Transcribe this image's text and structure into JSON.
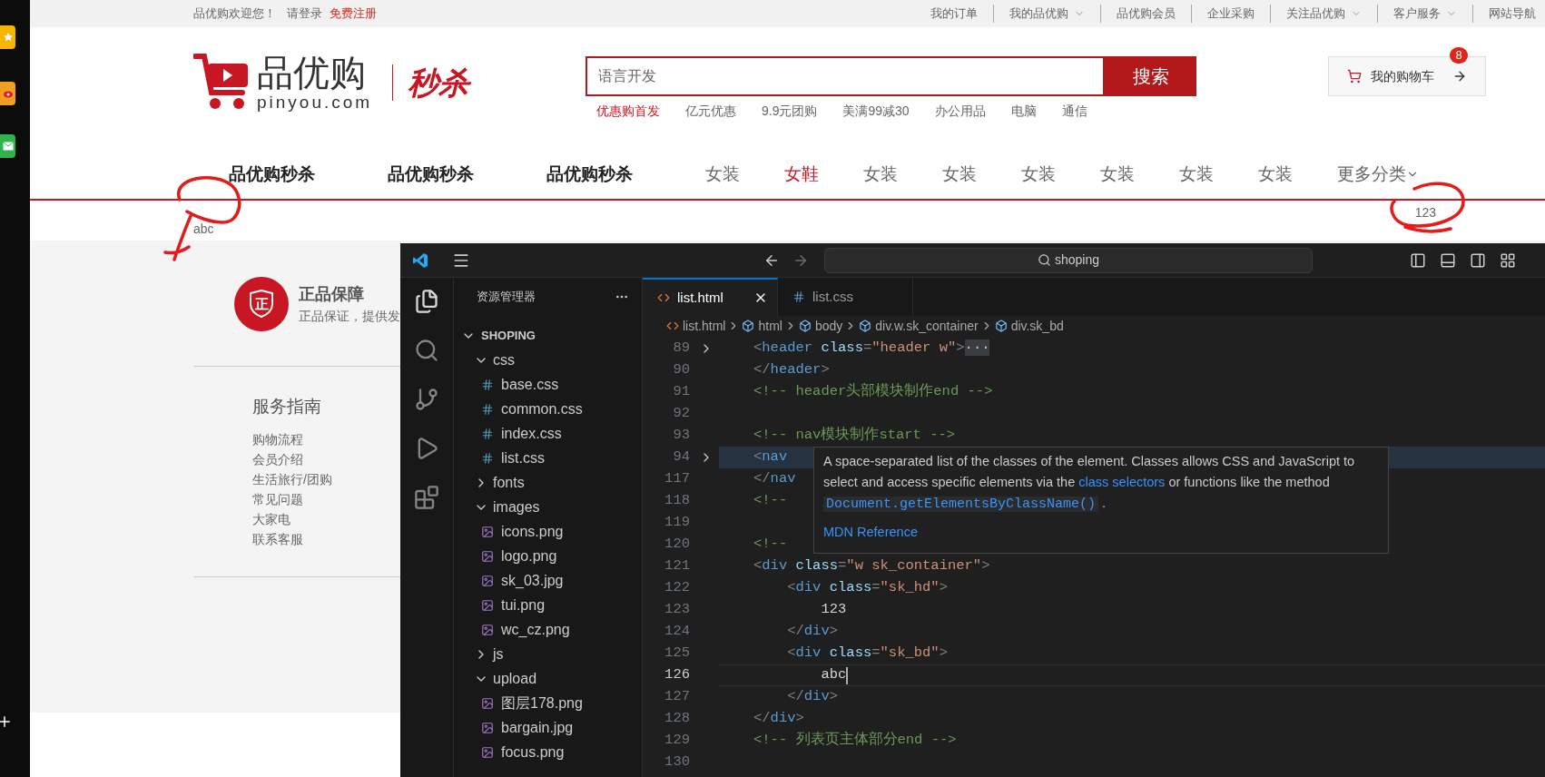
{
  "top_bar": {
    "welcome": "品优购欢迎您！",
    "login": "请登录",
    "register": "免费注册",
    "links": [
      {
        "label": "我的订单",
        "dropdown": false
      },
      {
        "label": "我的品优购",
        "dropdown": true
      },
      {
        "label": "品优购会员",
        "dropdown": false
      },
      {
        "label": "企业采购",
        "dropdown": false
      },
      {
        "label": "关注品优购",
        "dropdown": true
      },
      {
        "label": "客户服务",
        "dropdown": true
      },
      {
        "label": "网站导航",
        "dropdown": false
      }
    ]
  },
  "header": {
    "logo_name": "品优购",
    "logo_domain": "pinyou.com",
    "logo_badge": "秒杀",
    "search": {
      "placeholder": "语言开发",
      "button": "搜索"
    },
    "hot_words": [
      {
        "label": "优惠购首发",
        "highlight": true
      },
      {
        "label": "亿元优惠",
        "highlight": false
      },
      {
        "label": "9.9元团购",
        "highlight": false
      },
      {
        "label": "美满99减30",
        "highlight": false
      },
      {
        "label": "办公用品",
        "highlight": false
      },
      {
        "label": "电脑",
        "highlight": false
      },
      {
        "label": "通信",
        "highlight": false
      }
    ],
    "cart": {
      "label": "我的购物车",
      "count": "8"
    }
  },
  "nav": [
    {
      "label": "品优购秒杀",
      "kind": "bold"
    },
    {
      "label": "品优购秒杀",
      "kind": "bold"
    },
    {
      "label": "品优购秒杀",
      "kind": "bold"
    },
    {
      "label": "女装",
      "kind": "plain"
    },
    {
      "label": "女鞋",
      "kind": "active"
    },
    {
      "label": "女装",
      "kind": "plain"
    },
    {
      "label": "女装",
      "kind": "plain"
    },
    {
      "label": "女装",
      "kind": "plain"
    },
    {
      "label": "女装",
      "kind": "plain"
    },
    {
      "label": "女装",
      "kind": "plain"
    },
    {
      "label": "女装",
      "kind": "plain"
    },
    {
      "label": "更多分类",
      "kind": "more"
    }
  ],
  "sk_header": "123",
  "sk_body": "abc",
  "promise": {
    "icon_text": "正",
    "title": "正品保障",
    "text": "正品保证，提供发"
  },
  "guide": {
    "title": "服务指南",
    "links": [
      "购物流程",
      "会员介绍",
      "生活旅行/团购",
      "常见问题",
      "大家电",
      "联系客服"
    ]
  },
  "editor": {
    "search": "shoping",
    "explorer_title": "资源管理器",
    "folder": "SHOPING",
    "tree": [
      {
        "name": "css",
        "kind": "folder",
        "expanded": true,
        "children": [
          {
            "name": "base.css",
            "kind": "css"
          },
          {
            "name": "common.css",
            "kind": "css"
          },
          {
            "name": "index.css",
            "kind": "css"
          },
          {
            "name": "list.css",
            "kind": "css"
          }
        ]
      },
      {
        "name": "fonts",
        "kind": "folder",
        "expanded": false
      },
      {
        "name": "images",
        "kind": "folder",
        "expanded": true,
        "children": [
          {
            "name": "icons.png",
            "kind": "image"
          },
          {
            "name": "logo.png",
            "kind": "image"
          },
          {
            "name": "sk_03.jpg",
            "kind": "image"
          },
          {
            "name": "tui.png",
            "kind": "image"
          },
          {
            "name": "wc_cz.png",
            "kind": "image"
          }
        ]
      },
      {
        "name": "js",
        "kind": "folder",
        "expanded": false
      },
      {
        "name": "upload",
        "kind": "folder",
        "expanded": true,
        "children": [
          {
            "name": "图层178.png",
            "kind": "image"
          },
          {
            "name": "bargain.jpg",
            "kind": "image"
          },
          {
            "name": "focus.png",
            "kind": "image"
          }
        ]
      }
    ],
    "tabs": [
      {
        "label": "list.html",
        "kind": "html",
        "selected": true
      },
      {
        "label": "list.css",
        "kind": "css",
        "selected": false
      }
    ],
    "breadcrumb": [
      {
        "label": "list.html",
        "kind": "file"
      },
      {
        "label": "html",
        "kind": "element"
      },
      {
        "label": "body",
        "kind": "element"
      },
      {
        "label": "div.w.sk_container",
        "kind": "element"
      },
      {
        "label": "div.sk_bd",
        "kind": "element"
      }
    ],
    "lines": [
      {
        "number": "89",
        "folded": true,
        "hovered": false,
        "active": false,
        "tokens": [
          {
            "kind": "punct",
            "text": "<"
          },
          {
            "kind": "tag",
            "text": "header"
          },
          {
            "kind": "attr",
            "text": " class"
          },
          {
            "kind": "punct",
            "text": "="
          },
          {
            "kind": "string",
            "text": "\"header w\""
          },
          {
            "kind": "punct",
            "text": ">"
          },
          {
            "kind": "fold",
            "text": "···"
          }
        ]
      },
      {
        "number": "90",
        "folded": false,
        "hovered": false,
        "active": false,
        "tokens": [
          {
            "kind": "punct",
            "text": "</"
          },
          {
            "kind": "tag",
            "text": "header"
          },
          {
            "kind": "punct",
            "text": ">"
          }
        ]
      },
      {
        "number": "91",
        "folded": false,
        "hovered": false,
        "active": false,
        "tokens": [
          {
            "kind": "comment",
            "text": "<!-- header头部模块制作end -->"
          }
        ]
      },
      {
        "number": "92",
        "folded": false,
        "hovered": false,
        "active": false
      },
      {
        "number": "93",
        "folded": false,
        "hovered": false,
        "active": false,
        "tokens": [
          {
            "kind": "comment",
            "text": "<!-- nav模块制作start -->"
          }
        ]
      },
      {
        "number": "94",
        "folded": true,
        "hovered": true,
        "active": false,
        "tokens": [
          {
            "kind": "punct",
            "text": "<"
          },
          {
            "kind": "tag",
            "text": "nav"
          }
        ]
      },
      {
        "number": "117",
        "folded": false,
        "hovered": false,
        "active": false,
        "tokens": [
          {
            "kind": "punct",
            "text": "</"
          },
          {
            "kind": "tag",
            "text": "nav"
          }
        ]
      },
      {
        "number": "118",
        "folded": false,
        "hovered": false,
        "active": false,
        "tokens": [
          {
            "kind": "comment",
            "text": "<!--"
          }
        ]
      },
      {
        "number": "119",
        "folded": false,
        "hovered": false,
        "active": false
      },
      {
        "number": "120",
        "folded": false,
        "hovered": false,
        "active": false,
        "tokens": [
          {
            "kind": "comment",
            "text": "<!--"
          }
        ]
      },
      {
        "number": "121",
        "folded": false,
        "hovered": false,
        "active": false,
        "tokens": [
          {
            "kind": "punct",
            "text": "<"
          },
          {
            "kind": "tag",
            "text": "div"
          },
          {
            "kind": "attr",
            "text": " class"
          },
          {
            "kind": "punct",
            "text": "="
          },
          {
            "kind": "string",
            "text": "\"w sk_container\""
          },
          {
            "kind": "punct",
            "text": ">"
          }
        ]
      },
      {
        "number": "122",
        "folded": false,
        "hovered": false,
        "active": false,
        "tokens": [
          {
            "kind": "punct",
            "text": "    <"
          },
          {
            "kind": "tag",
            "text": "div"
          },
          {
            "kind": "attr",
            "text": " class"
          },
          {
            "kind": "punct",
            "text": "="
          },
          {
            "kind": "string",
            "text": "\"sk_hd\""
          },
          {
            "kind": "punct",
            "text": ">"
          }
        ]
      },
      {
        "number": "123",
        "folded": false,
        "hovered": false,
        "active": false,
        "tokens": [
          {
            "kind": "text",
            "text": "        123"
          }
        ]
      },
      {
        "number": "124",
        "folded": false,
        "hovered": false,
        "active": false,
        "tokens": [
          {
            "kind": "punct",
            "text": "    </"
          },
          {
            "kind": "tag",
            "text": "div"
          },
          {
            "kind": "punct",
            "text": ">"
          }
        ]
      },
      {
        "number": "125",
        "folded": false,
        "hovered": false,
        "active": false,
        "tokens": [
          {
            "kind": "punct",
            "text": "    <"
          },
          {
            "kind": "tag",
            "text": "div"
          },
          {
            "kind": "attr",
            "text": " class"
          },
          {
            "kind": "punct",
            "text": "="
          },
          {
            "kind": "string",
            "text": "\"sk_bd\""
          },
          {
            "kind": "punct",
            "text": ">"
          }
        ]
      },
      {
        "number": "126",
        "folded": false,
        "hovered": false,
        "active": true,
        "tokens": [
          {
            "kind": "text",
            "text": "        abc"
          }
        ]
      },
      {
        "number": "127",
        "folded": false,
        "hovered": false,
        "active": false,
        "tokens": [
          {
            "kind": "punct",
            "text": "    </"
          },
          {
            "kind": "tag",
            "text": "div"
          },
          {
            "kind": "punct",
            "text": ">"
          }
        ]
      },
      {
        "number": "128",
        "folded": false,
        "hovered": false,
        "active": false,
        "tokens": [
          {
            "kind": "punct",
            "text": "</"
          },
          {
            "kind": "tag",
            "text": "div"
          },
          {
            "kind": "punct",
            "text": ">"
          }
        ]
      },
      {
        "number": "129",
        "folded": false,
        "hovered": false,
        "active": false,
        "tokens": [
          {
            "kind": "comment",
            "text": "<!-- 列表页主体部分end -->"
          }
        ]
      },
      {
        "number": "130",
        "folded": false,
        "hovered": false,
        "active": false
      }
    ],
    "tooltip": {
      "parts": [
        {
          "kind": "text",
          "text": "A space-separated list of the classes of the element. Classes allows CSS and JavaScript to select and access specific elements via the "
        },
        {
          "kind": "link",
          "text": "class selectors"
        },
        {
          "kind": "text",
          "text": " or functions like the method "
        },
        {
          "kind": "code",
          "text": "Document.getElementsByClassName()"
        },
        {
          "kind": "text",
          "text": " ."
        }
      ],
      "link": "MDN Reference"
    }
  }
}
